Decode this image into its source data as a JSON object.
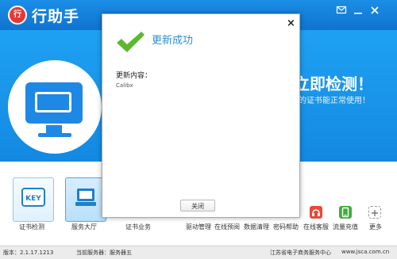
{
  "app": {
    "title": "行助手",
    "logo_text": "行",
    "message_icon": "message-icon",
    "minimize_icon": "minimize-icon",
    "close_icon": "close-icon"
  },
  "banner": {
    "headline": "立即检测！",
    "subtext": "的证书能正常使用！"
  },
  "tools": {
    "tiles": [
      {
        "label": "证书检测",
        "icon": "key-icon"
      },
      {
        "label": "服务大厅",
        "icon": "terminal-icon"
      }
    ],
    "links": [
      {
        "label": "证书业务"
      },
      {
        "label": "驱动管理"
      },
      {
        "label": "在线预阅"
      },
      {
        "label": "数据清理"
      },
      {
        "label": "密码帮助"
      },
      {
        "label": "在线客服",
        "icon": "headset-icon"
      },
      {
        "label": "流量充值",
        "icon": "phone-charge-icon"
      },
      {
        "label": "更多",
        "icon": "plus-icon"
      }
    ]
  },
  "status": {
    "version": "版本：2.1.17.1213",
    "server": "当前服务器：服务器五",
    "company": "江苏省电子商务服务中心",
    "website": "www.jsca.com.cn"
  },
  "dialog": {
    "title": "更新成功",
    "content_label": "更新内容：",
    "content_value": "Calibx",
    "button_label": "关闭",
    "close_symbol": "×"
  },
  "colors": {
    "titlebar": "#1586dd",
    "banner": "#1a96ec",
    "dialog_title": "#2a8fd6",
    "check_green": "#5cb82e"
  }
}
